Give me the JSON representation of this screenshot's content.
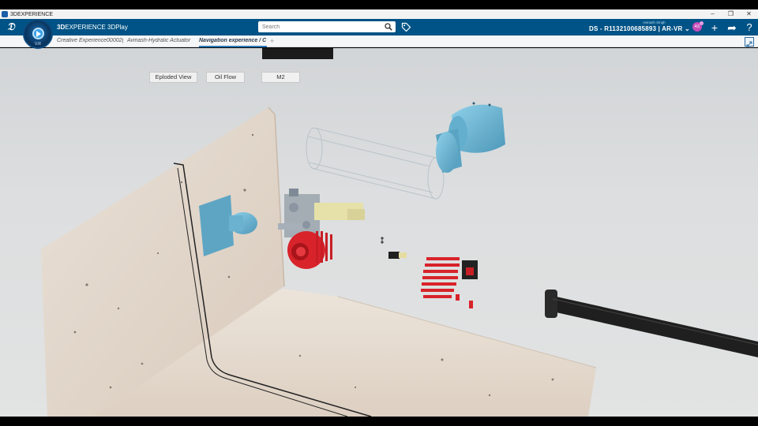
{
  "window": {
    "title": "3DEXPERIENCE",
    "buttons": [
      "–",
      "❐",
      "✕"
    ]
  },
  "topbar": {
    "brand_bold": "3D",
    "brand_rest": "EXPERIENCE 3DPlay",
    "compass_version": "V.R",
    "search_placeholder": "Search",
    "context": "DS - R1132100685893 | AR-VR",
    "username": "Avinash Singh",
    "avatar_initials": "AS",
    "icons": [
      "search-icon",
      "tag-icon",
      "plus-icon",
      "share-icon",
      "help-icon"
    ],
    "colors": {
      "bar": "#005386",
      "avatar": "#c44bb8"
    }
  },
  "tabs": [
    {
      "label": "Creative Experience00002(",
      "active": false
    },
    {
      "label": "Avinash-Hydralic Actuator",
      "active": false
    },
    {
      "label": "Navigation experience / C",
      "active": true
    }
  ],
  "tab_add": "+",
  "viewport": {
    "buttons": [
      {
        "label": "Eploded View"
      },
      {
        "label": "Oil Flow"
      },
      {
        "label": "M2"
      }
    ],
    "colors": {
      "housing": "#6bb6d4",
      "red_parts": "#d8232a",
      "wall": "#e8ddd2"
    }
  }
}
